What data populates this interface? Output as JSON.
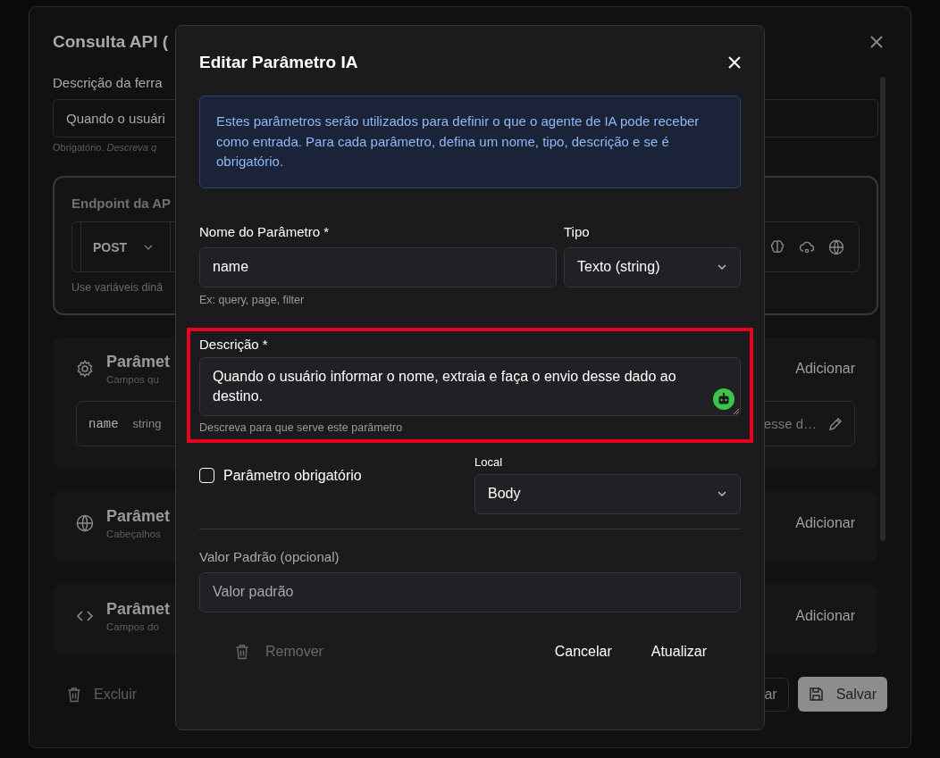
{
  "background_dialog": {
    "title": "Consulta API (",
    "tool_description": {
      "label": "Descrição da ferra",
      "value": "Quando o usuári",
      "hint": "Obrigatório. *Descreva q*"
    },
    "endpoint": {
      "title": "Endpoint da AP",
      "method": "POST",
      "hint": "Use variáveis dinâ"
    },
    "sections": [
      {
        "kind": "gear",
        "title": "Parâmet",
        "subtitle": "Campos qu",
        "action": "Adicionar",
        "items": [
          {
            "name": "name",
            "type": "string",
            "description": "esse d…"
          }
        ]
      },
      {
        "kind": "globe",
        "title": "Parâmet",
        "subtitle": "Cabeçalhos",
        "action": "Adicionar"
      },
      {
        "kind": "code",
        "title": "Parâmet",
        "subtitle": "Campos do",
        "action": "Adicionar"
      }
    ],
    "footer": {
      "delete": "Excluir",
      "cancel": "ar",
      "save": "Salvar"
    }
  },
  "dialog": {
    "title": "Editar Parâmetro IA",
    "info": "Estes parâmetros serão utilizados para definir o que o agente de IA pode receber como entrada. Para cada parâmetro, defina um nome, tipo, descrição e se é obrigatório.",
    "name_field": {
      "label": "Nome do Parâmetro *",
      "value": "name",
      "hint": "Ex: query, page, filter"
    },
    "type_select": {
      "label": "Tipo",
      "value": "Texto (string)"
    },
    "description": {
      "label": "Descrição *",
      "value": "Quando o usuário informar o nome, extraia e faça o envio desse dado ao destino.",
      "hint": "Descreva para que serve este parâmetro",
      "highlighted": true
    },
    "required": {
      "label": "Parâmetro obrigatório",
      "checked": false
    },
    "location": {
      "label": "Local",
      "value": "Body"
    },
    "default_value": {
      "label": "Valor Padrão (opcional)",
      "placeholder": "Valor padrão"
    },
    "buttons": {
      "remove": {
        "label": "Remover",
        "disabled": true
      },
      "cancel": "Cancelar",
      "update": "Atualizar"
    }
  }
}
